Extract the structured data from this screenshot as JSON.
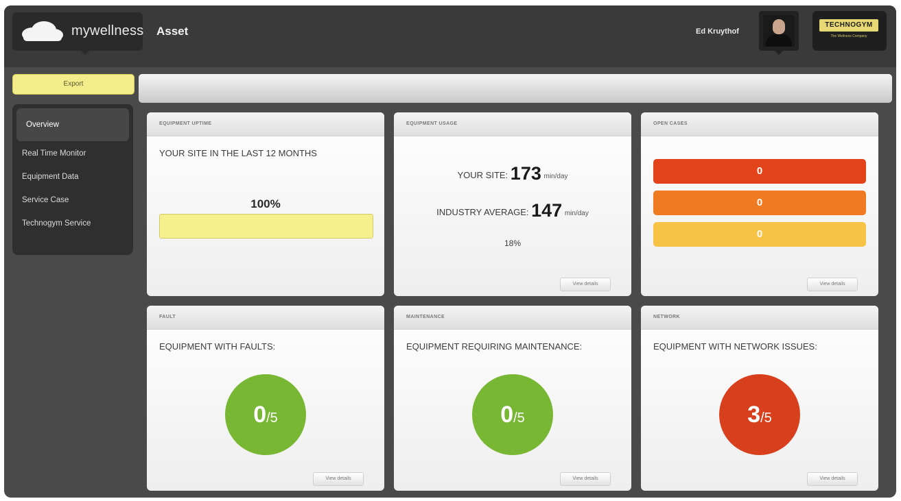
{
  "header": {
    "brand": "mywellness",
    "page_title": "Asset",
    "user_name": "Ed Kruythof",
    "partner_logo": "TECHNOGYM",
    "partner_tagline": "The Wellness Company"
  },
  "actions": {
    "export_label": "Export"
  },
  "sidebar": {
    "items": [
      {
        "label": "Overview",
        "active": true
      },
      {
        "label": "Real Time Monitor"
      },
      {
        "label": "Equipment Data"
      },
      {
        "label": "Service Case"
      },
      {
        "label": "Technogym Service"
      }
    ]
  },
  "cards": {
    "uptime": {
      "title": "EQUIPMENT UPTIME",
      "subtitle": "YOUR SITE IN THE LAST 12 MONTHS",
      "percent_label": "100%",
      "percent": 100
    },
    "usage": {
      "title": "EQUIPMENT USAGE",
      "site_label": "YOUR SITE:",
      "site_value": "173",
      "unit": "min/day",
      "industry_label": "INDUSTRY AVERAGE:",
      "industry_value": "147",
      "diff": "18%",
      "view_details": "View details"
    },
    "cases": {
      "title": "OPEN CASES",
      "counts": [
        "0",
        "0",
        "0"
      ],
      "colors": [
        "#e2431b",
        "#f07a22",
        "#f6c346"
      ],
      "view_details": "View details"
    },
    "fault": {
      "title": "FAULT",
      "heading": "EQUIPMENT WITH FAULTS:",
      "value": "0",
      "total": "/5",
      "color": "#77b734",
      "view_details": "View details"
    },
    "maintenance": {
      "title": "MAINTENANCE",
      "heading": "EQUIPMENT REQUIRING MAINTENANCE:",
      "value": "0",
      "total": "/5",
      "color": "#77b734",
      "view_details": "View details"
    },
    "network": {
      "title": "NETWORK",
      "heading": "EQUIPMENT WITH NETWORK ISSUES:",
      "value": "3",
      "total": "/5",
      "color": "#d8401d",
      "view_details": "View details"
    }
  }
}
